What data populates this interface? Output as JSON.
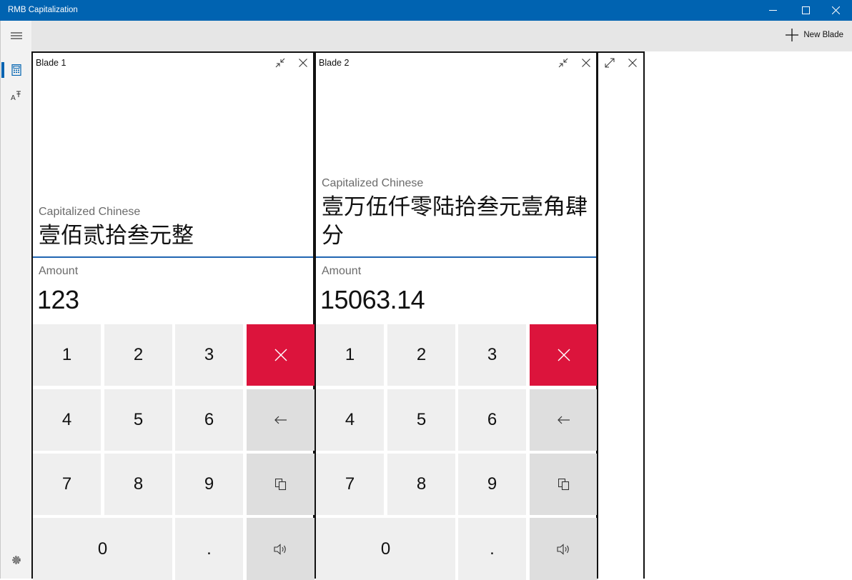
{
  "window": {
    "title": "RMB Capitalization"
  },
  "toolbar": {
    "new_blade_label": "New Blade"
  },
  "blades": [
    {
      "title": "Blade 1",
      "capitalized_label": "Capitalized Chinese",
      "capitalized_value": "壹佰贰拾叁元整",
      "amount_label": "Amount",
      "amount_value": "123",
      "keys": [
        "1",
        "2",
        "3",
        "4",
        "5",
        "6",
        "7",
        "8",
        "9",
        "0",
        "."
      ]
    },
    {
      "title": "Blade 2",
      "capitalized_label": "Capitalized Chinese",
      "capitalized_value": "壹万伍仟零陆拾叁元壹角肆分",
      "amount_label": "Amount",
      "amount_value": "15063.14",
      "keys": [
        "1",
        "2",
        "3",
        "4",
        "5",
        "6",
        "7",
        "8",
        "9",
        "0",
        "."
      ]
    }
  ],
  "colors": {
    "accent": "#0063b1",
    "clear_key": "#dc143c",
    "divider": "#2166b2"
  },
  "icons": [
    "hamburger-icon",
    "calculator-icon",
    "font-size-icon",
    "settings-icon",
    "add-icon",
    "collapse-icon",
    "expand-icon",
    "close-icon",
    "backspace-icon",
    "copy-icon",
    "speaker-icon"
  ]
}
